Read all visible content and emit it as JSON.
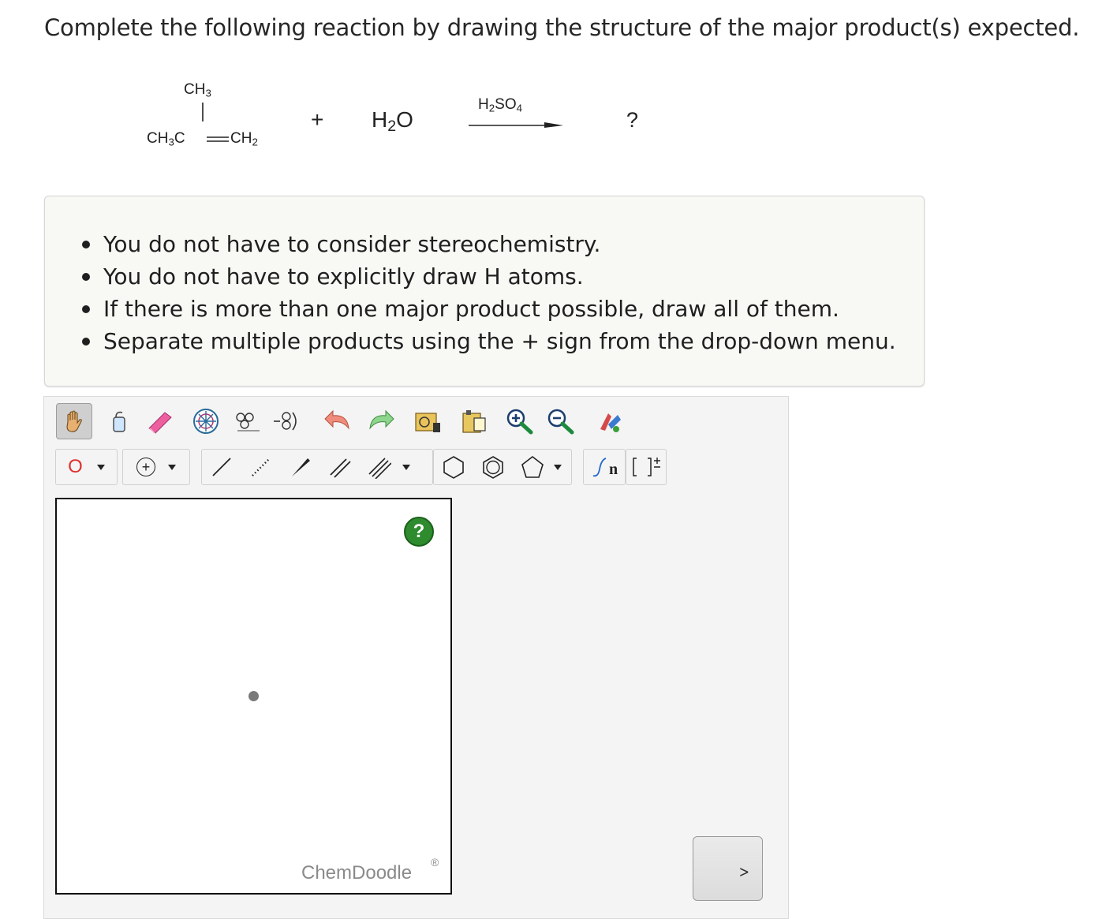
{
  "question": "Complete the following reaction by drawing the structure of the major product(s) expected.",
  "reaction": {
    "reactant_top": "CH3",
    "reactant_left": "CH3C",
    "reactant_right": "CH2",
    "plus": "+",
    "water": "H2O",
    "reagent": "H2SO4",
    "product": "?"
  },
  "instructions": [
    "You do not have to consider stereochemistry.",
    "You do not have to explicitly draw H atoms.",
    "If there is more than one major product possible, draw all of them.",
    "Separate multiple products using the + sign from the drop-down menu."
  ],
  "toolbar_row1": [
    "hand-icon",
    "lasso-icon",
    "eraser-icon",
    "center-icon",
    "flip-icon",
    "rotate-icon",
    "undo-icon",
    "redo-icon",
    "template-icon",
    "clipboard-icon",
    "zoom-in-icon",
    "zoom-out-icon",
    "clean-icon"
  ],
  "toolbar_row2": {
    "atom_label": "O",
    "charge_label": "+",
    "polymer_label": "n"
  },
  "sketcher": {
    "help_label": "?",
    "brand": "ChemDoodle",
    "brand_mark": "®"
  }
}
